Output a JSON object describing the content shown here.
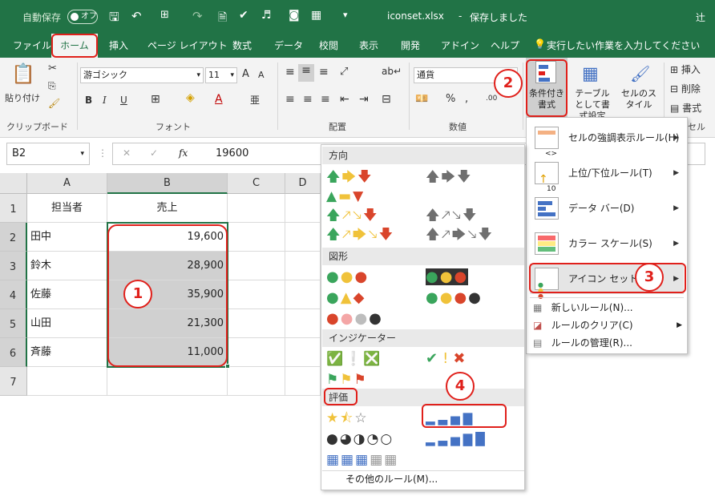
{
  "titlebar": {
    "autosave": "自動保存",
    "toggle": "オフ",
    "filename": "iconset.xlsx",
    "sep": "-",
    "status": "保存しました",
    "user": "辻"
  },
  "tabs": [
    "ファイル",
    "ホーム",
    "挿入",
    "ページ レイアウト",
    "数式",
    "データ",
    "校閲",
    "表示",
    "開発",
    "アドイン",
    "ヘルプ"
  ],
  "tell_me": "実行したい作業を入力してください",
  "ribbon": {
    "paste": "貼り付け",
    "clipboard": "クリップボード",
    "font_name": "游ゴシック",
    "font_size": "11",
    "font_group": "フォント",
    "bold": "B",
    "italic": "I",
    "underline": "U",
    "font_grow": "A",
    "font_shrink": "A",
    "align_group": "配置",
    "number_format": "通貨",
    "number_group": "数値",
    "percent": "%",
    "comma": ",",
    "dec_inc": ".00",
    "cond_format": "条件付き書式",
    "table_format": "テーブルとして書式設定",
    "cell_style": "セルのスタイル",
    "insert": "挿入",
    "delete": "削除",
    "format": "書式",
    "cells_group": "セル"
  },
  "formula_bar": {
    "name_box": "B2",
    "cancel": "✕",
    "enter": "✓",
    "fx": "fx",
    "value": "19600"
  },
  "grid": {
    "columns": [
      "A",
      "B",
      "C",
      "D"
    ],
    "rows": [
      "1",
      "2",
      "3",
      "4",
      "5",
      "6",
      "7"
    ],
    "header_a": "担当者",
    "header_b": "売上",
    "data": [
      {
        "name": "田中",
        "value": "19,600"
      },
      {
        "name": "鈴木",
        "value": "28,900"
      },
      {
        "name": "佐藤",
        "value": "35,900"
      },
      {
        "name": "山田",
        "value": "21,300"
      },
      {
        "name": "斉藤",
        "value": "11,000"
      }
    ]
  },
  "cf_menu": {
    "items": [
      {
        "label": "セルの強調表示ルール(H)"
      },
      {
        "label": "上位/下位ルール(T)"
      },
      {
        "label": "データ バー(D)"
      },
      {
        "label": "カラー スケール(S)"
      },
      {
        "label": "アイコン セット(I)"
      }
    ],
    "small": [
      "新しいルール(N)...",
      "ルールのクリア(C)",
      "ルールの管理(R)..."
    ]
  },
  "icon_menu": {
    "sections": [
      "方向",
      "図形",
      "インジケーター",
      "評価"
    ],
    "more": "その他のルール(M)..."
  },
  "markers": [
    "1",
    "2",
    "3",
    "4"
  ],
  "colors": {
    "excel_green": "#217346",
    "highlight": "#e0201b",
    "green": "#3aa55c",
    "yellow": "#f0c23a",
    "red": "#d9452b",
    "gray": "#6f6f6f"
  }
}
